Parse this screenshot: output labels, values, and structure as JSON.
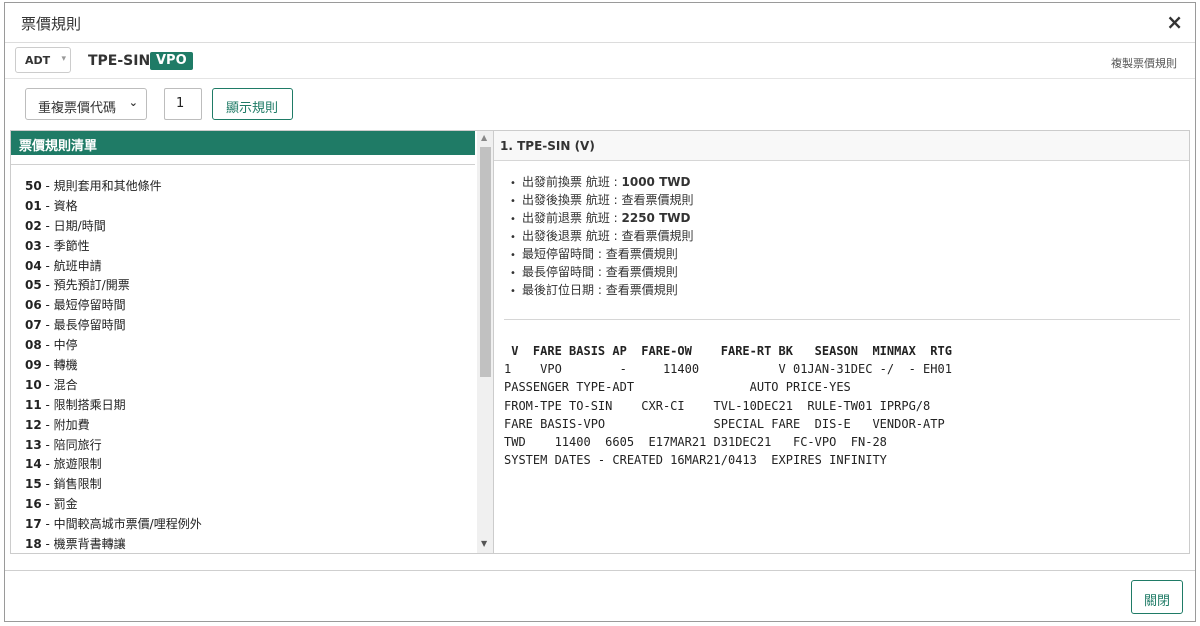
{
  "dialog": {
    "title": "票價規則",
    "close_icon": "close-icon",
    "close_glyph": "×"
  },
  "subbar": {
    "passenger_type": "ADT",
    "route": "TPE-SIN:",
    "fare_code": "VPO",
    "copy_label": "複製票價規則",
    "accent_color": "#1f7b66"
  },
  "toolbar": {
    "duplicate_dropdown_label": "重複票價代碼",
    "rule_number": "1",
    "show_rules_label": "顯示規則"
  },
  "rule_list": {
    "header": "票價規則清單",
    "items": [
      {
        "code": "50",
        "label": "規則套用和其他條件"
      },
      {
        "code": "01",
        "label": "資格"
      },
      {
        "code": "02",
        "label": "日期/時間"
      },
      {
        "code": "03",
        "label": "季節性"
      },
      {
        "code": "04",
        "label": "航班申請"
      },
      {
        "code": "05",
        "label": "預先預訂/開票"
      },
      {
        "code": "06",
        "label": "最短停留時間"
      },
      {
        "code": "07",
        "label": "最長停留時間"
      },
      {
        "code": "08",
        "label": "中停"
      },
      {
        "code": "09",
        "label": "轉機"
      },
      {
        "code": "10",
        "label": "混合"
      },
      {
        "code": "11",
        "label": "限制搭乘日期"
      },
      {
        "code": "12",
        "label": "附加費"
      },
      {
        "code": "13",
        "label": "陪同旅行"
      },
      {
        "code": "14",
        "label": "旅遊限制"
      },
      {
        "code": "15",
        "label": "銷售限制"
      },
      {
        "code": "16",
        "label": "罰金"
      },
      {
        "code": "17",
        "label": "中間較高城市票價/哩程例外"
      },
      {
        "code": "18",
        "label": "機票背書轉讓"
      }
    ]
  },
  "detail": {
    "header": "1. TPE-SIN (V)",
    "summary": [
      {
        "label": "出發前換票 航班 : ",
        "value": "1000 TWD",
        "bold": true
      },
      {
        "label": "出發後換票 航班 : ",
        "value": "查看票價規則",
        "bold": false
      },
      {
        "label": "出發前退票 航班 : ",
        "value": "2250 TWD",
        "bold": true
      },
      {
        "label": "出發後退票 航班 : ",
        "value": "查看票價規則",
        "bold": false
      },
      {
        "label": "最短停留時間 : ",
        "value": "查看票價規則",
        "bold": false
      },
      {
        "label": "最長停留時間 : ",
        "value": "查看票價規則",
        "bold": false
      },
      {
        "label": "最後訂位日期 : ",
        "value": "查看票價規則",
        "bold": false
      }
    ],
    "fare_text_header": " V  FARE BASIS AP  FARE-OW    FARE-RT BK   SEASON  MINMAX  RTG",
    "fare_text_lines": [
      "1    VPO        -     11400           V 01JAN-31DEC -/  - EH01",
      "PASSENGER TYPE-ADT                AUTO PRICE-YES",
      "FROM-TPE TO-SIN    CXR-CI    TVL-10DEC21  RULE-TW01 IPRPG/8",
      "FARE BASIS-VPO               SPECIAL FARE  DIS-E   VENDOR-ATP",
      "TWD    11400  6605  E17MAR21 D31DEC21   FC-VPO  FN-28",
      "SYSTEM DATES - CREATED 16MAR21/0413  EXPIRES INFINITY"
    ]
  },
  "footer": {
    "close_label": "關閉"
  }
}
